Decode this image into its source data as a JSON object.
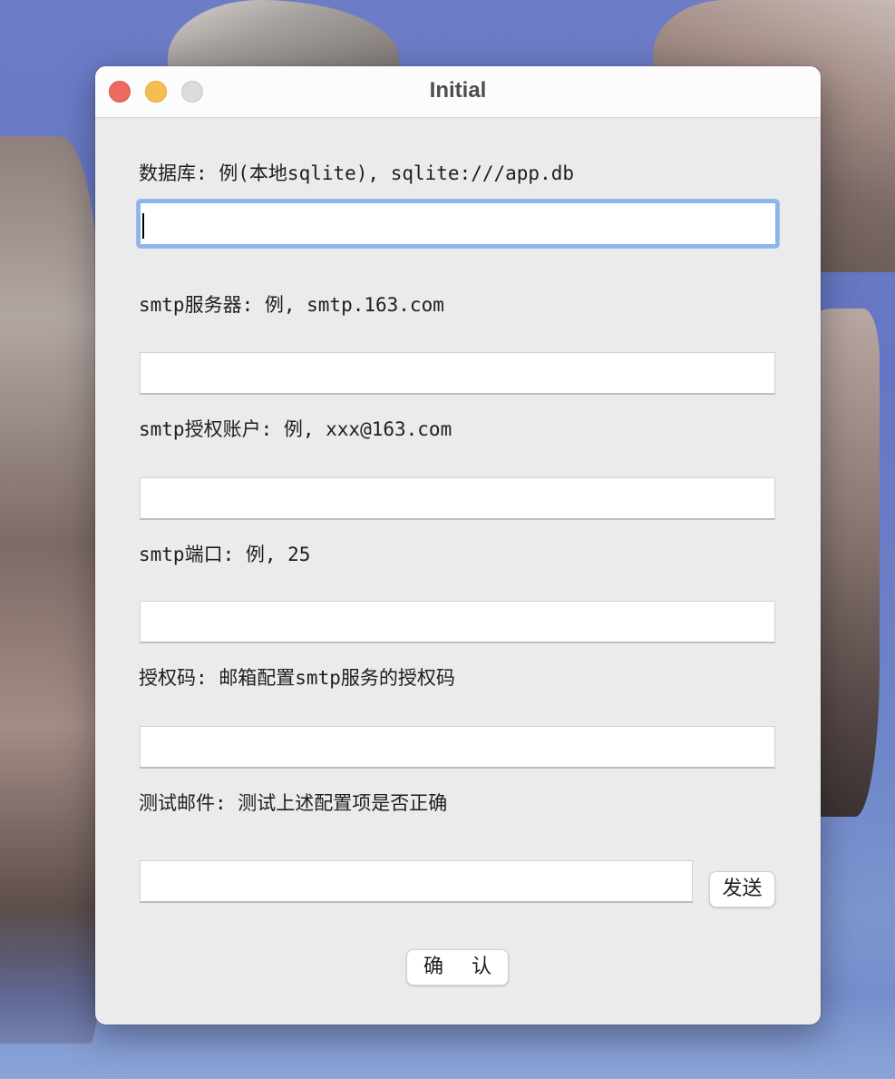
{
  "window": {
    "title": "Initial"
  },
  "fields": [
    {
      "label": "数据库: 例(本地sqlite), sqlite:///app.db",
      "value": ""
    },
    {
      "label": "smtp服务器: 例, smtp.163.com",
      "value": ""
    },
    {
      "label": "smtp授权账户: 例, xxx@163.com",
      "value": ""
    },
    {
      "label": "smtp端口: 例, 25",
      "value": ""
    },
    {
      "label": "授权码: 邮箱配置smtp服务的授权码",
      "value": ""
    },
    {
      "label": "测试邮件: 测试上述配置项是否正确",
      "value": ""
    }
  ],
  "buttons": {
    "send_label": "发送",
    "confirm_label": "确 认"
  },
  "colors": {
    "close": "#ed6a5e",
    "minimize": "#f5bf4f",
    "maximize": "#dcdcdc",
    "focus_ring": "#8fb4ea"
  }
}
